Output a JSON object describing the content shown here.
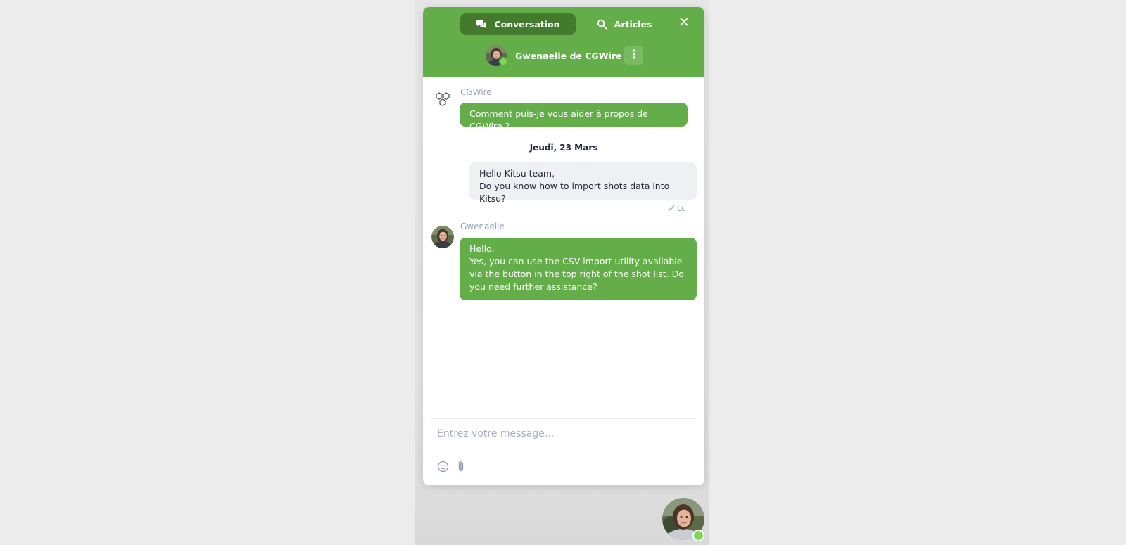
{
  "header": {
    "tabs": [
      {
        "label": "Conversation",
        "icon": "chat-bubbles-icon",
        "active": true
      },
      {
        "label": "Articles",
        "icon": "search-icon",
        "active": false
      }
    ],
    "close_icon": "close-icon",
    "agent_name": "Gwenaelle de CGWire",
    "menu_icon": "kebab-menu-icon",
    "agent_status": "online"
  },
  "messages": {
    "bot_sender": "CGWire",
    "bot_message": "Comment puis-je vous aider à propos de CGWire ?",
    "date_separator": "Jeudi, 23 Mars",
    "user_message_line1": "Hello Kitsu team,",
    "user_message_line2": "Do you know how to import shots data into Kitsu?",
    "read_status": "Lu",
    "agent_sender": "Gwenaelle",
    "agent_message_line1": "Hello,",
    "agent_message_line2": "Yes, you can use the CSV import utility available via the button in the top right of the shot list. Do you need further assistance?"
  },
  "compose": {
    "placeholder": "Entrez votre message...",
    "value": "",
    "tools": [
      "emoji-icon",
      "paperclip-icon"
    ]
  },
  "colors": {
    "brand_green": "#63ae48",
    "active_tab": "#437a2e",
    "online": "#7ed957"
  }
}
